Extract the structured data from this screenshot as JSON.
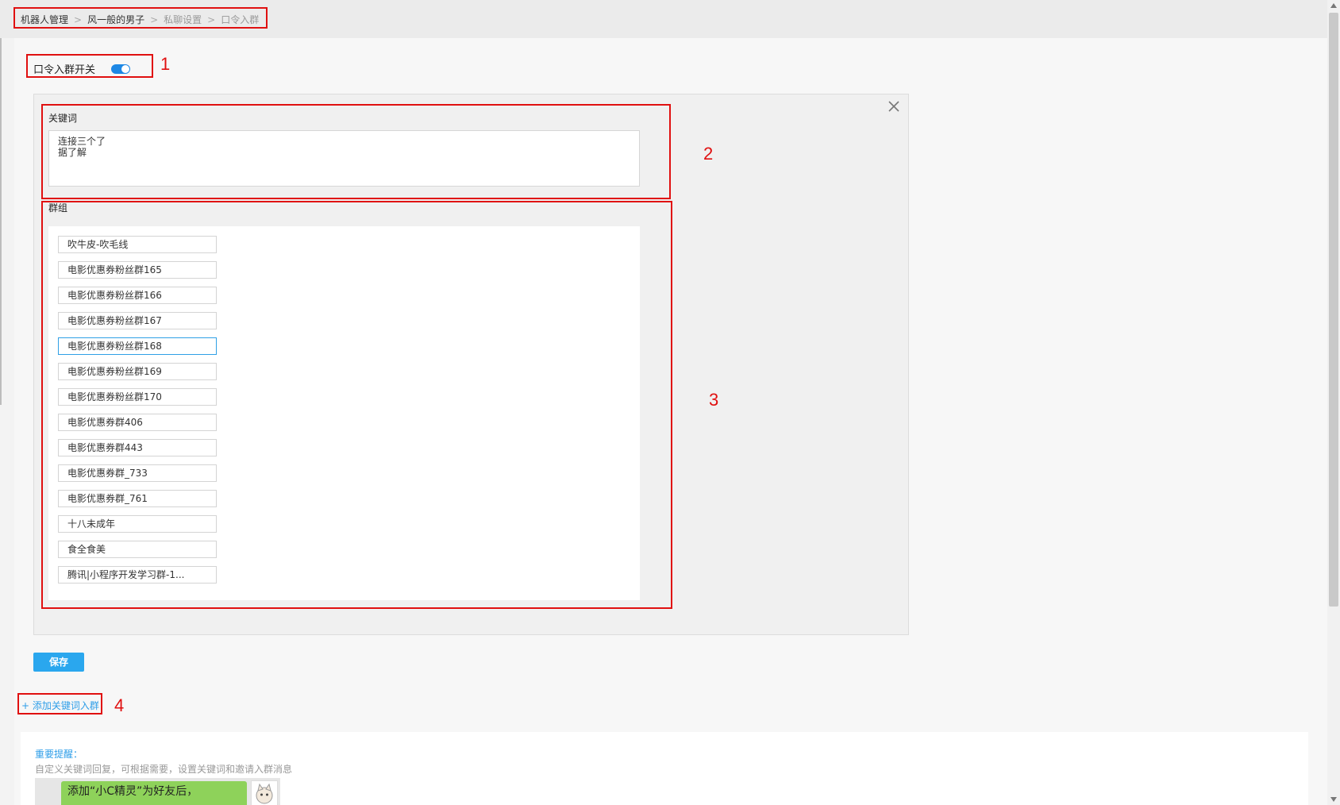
{
  "breadcrumb": {
    "items": [
      "机器人管理",
      "风一般的男子",
      "私聊设置",
      "口令入群"
    ],
    "separator": ">"
  },
  "toggle": {
    "label": "口令入群开关",
    "on": true,
    "color": "#1e88e5"
  },
  "keyword": {
    "label": "关键词",
    "lines": [
      "连接三个了",
      "据了解"
    ]
  },
  "groups": {
    "label": "群组",
    "items": [
      "吹牛皮-吹毛线",
      "电影优惠券粉丝群165",
      "电影优惠券粉丝群166",
      "电影优惠券粉丝群167",
      "电影优惠券粉丝群168",
      "电影优惠券粉丝群169",
      "电影优惠券粉丝群170",
      "电影优惠券群406",
      "电影优惠券群443",
      "电影优惠券群_733",
      "电影优惠券群_761",
      "十八未成年",
      "食全食美",
      "腾讯|小程序开发学习群-1..."
    ],
    "active_index": 4
  },
  "save_label": "保存",
  "add_keyword_label": "+ 添加关键词入群",
  "tips": {
    "title": "重要提醒：",
    "text": "自定义关键词回复，可根据需要，设置关键词和邀请入群消息",
    "bubble_text": "添加“小C精灵”为好友后，"
  },
  "markers": [
    "1",
    "2",
    "3",
    "4"
  ],
  "colors": {
    "accent": "#2aa7ee",
    "annotation": "#e01010"
  }
}
